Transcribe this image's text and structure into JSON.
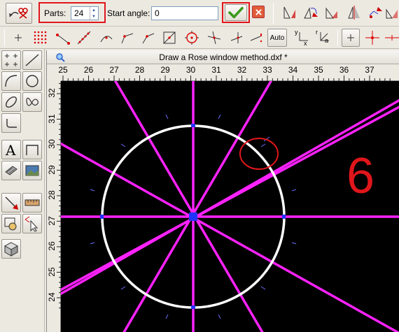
{
  "toolbar": {
    "parts_label": "Parts:",
    "parts_value": "24",
    "start_angle_label": "Start angle:",
    "start_angle_value": "0",
    "auto_label": "Auto",
    "coord_y_label": "y",
    "coord_x_label": "x",
    "coord_r_label": "r",
    "coord_a_label": "a"
  },
  "window": {
    "title": "Draw a Rose window method.dxf *"
  },
  "rulers": {
    "x_ticks": [
      "25",
      "26",
      "27",
      "28",
      "29",
      "30",
      "31",
      "32",
      "33",
      "34",
      "35",
      "36",
      "37"
    ],
    "y_ticks": [
      "32",
      "31",
      "30",
      "29",
      "28",
      "27",
      "26",
      "25",
      "24"
    ]
  },
  "annotation": {
    "step_number": "6"
  },
  "colors": {
    "highlight": "#e0161b",
    "magenta": "#ff22ff",
    "accept_green": "#3a9a1a",
    "cancel_red": "#e25c3a"
  }
}
